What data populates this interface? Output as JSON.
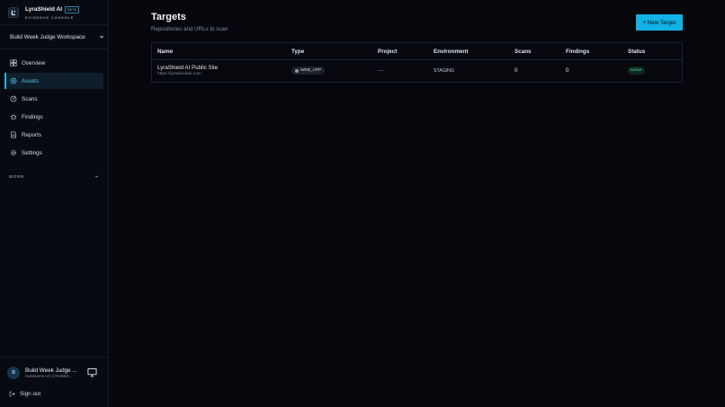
{
  "brand": {
    "name": "LyraShield AI",
    "badge": "BETA",
    "subtitle": "EVIDENCE CONSOLE"
  },
  "workspace": {
    "name": "Build Week Judge Workspace"
  },
  "sidebar": {
    "items": [
      {
        "label": "Overview",
        "icon": "grid-icon",
        "active": false
      },
      {
        "label": "Assets",
        "icon": "target-icon",
        "active": true
      },
      {
        "label": "Scans",
        "icon": "radar-icon",
        "active": false
      },
      {
        "label": "Findings",
        "icon": "bug-icon",
        "active": false
      },
      {
        "label": "Reports",
        "icon": "document-icon",
        "active": false
      },
      {
        "label": "Settings",
        "icon": "gear-icon",
        "active": false
      }
    ],
    "more_label": "MORE"
  },
  "user": {
    "initial": "B",
    "name": "Build Week Judge ...",
    "email": "buildweek-v2-1764569..."
  },
  "signout_label": "Sign out",
  "page": {
    "title": "Targets",
    "subtitle": "Repositories and URLs to scan",
    "new_button": "New Target"
  },
  "table": {
    "columns": [
      "Name",
      "Type",
      "Project",
      "Environment",
      "Scans",
      "Findings",
      "Status"
    ],
    "rows": [
      {
        "name": "LyraShield AI Public Site",
        "url": "https://lyrashieldai.com",
        "type": "WEB_APP",
        "project": "—",
        "environment": "STAGING",
        "scans": "0",
        "findings": "0",
        "status": "active"
      }
    ]
  },
  "colors": {
    "accent": "#12b1e6",
    "background": "#05070c",
    "status_active": "#4ed79a"
  }
}
